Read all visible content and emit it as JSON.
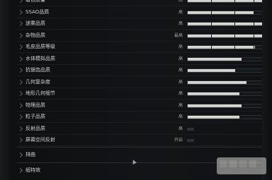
{
  "settings": [
    {
      "label": "着色质量",
      "value": "高",
      "fill": 0.92,
      "segmented": true
    },
    {
      "label": "SSAO品质",
      "value": "高",
      "fill": 0.76,
      "segmented": true
    },
    {
      "label": "迷雾品质",
      "value": "高",
      "fill": 0.92,
      "segmented": true
    },
    {
      "label": "杂物品质",
      "value": "最高",
      "fill": 0.94,
      "segmented": true
    },
    {
      "label": "毛皮品质等级",
      "value": "高",
      "fill": 0.78,
      "segmented": true
    },
    {
      "label": "水体模拟品质",
      "value": "高",
      "fill": 0.62,
      "segmented": false
    },
    {
      "label": "抗锯齿品质",
      "value": "高",
      "fill": 0.55,
      "segmented": false
    },
    {
      "label": "几何复杂度",
      "value": "高",
      "fill": 0.68,
      "segmented": false
    },
    {
      "label": "地形几何细节",
      "value": "高",
      "fill": 0.6,
      "segmented": false
    },
    {
      "label": "物理品质",
      "value": "高",
      "fill": 0.62,
      "segmented": false
    },
    {
      "label": "粒子品质",
      "value": "高",
      "fill": 0.6,
      "segmented": false
    },
    {
      "label": "反射品质",
      "value": "高",
      "fill": 0.0,
      "segmented": false
    },
    {
      "label": "屏幕空间反射",
      "value": "开启",
      "fill": 0.0,
      "segmented": false
    }
  ],
  "sections": [
    {
      "label": "排曲"
    },
    {
      "label": "纸特效"
    }
  ],
  "colors": {
    "background": "#0d0f11",
    "fill": "#e3e4df",
    "track": "#15181b"
  }
}
